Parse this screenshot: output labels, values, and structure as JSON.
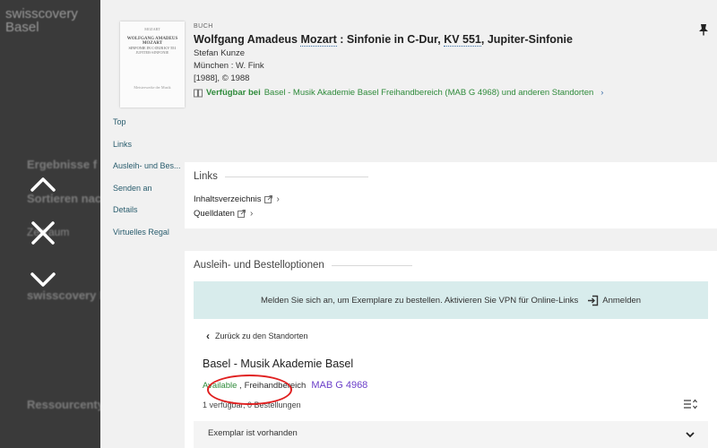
{
  "background": {
    "logo_line1": "swisscovery",
    "logo_line2": "Basel",
    "texts": [
      "Ergebnisse f",
      "Sortieren nac",
      "Zeitraum",
      "swisscovery B",
      "Ressourcenty"
    ]
  },
  "lightbox": {
    "prev_icon": "chevron-up-icon",
    "close_icon": "close-icon",
    "next_icon": "chevron-down-icon"
  },
  "record": {
    "type": "BUCH",
    "title_prefix": "Wolfgang Amadeus ",
    "title_link1": "Mozart",
    "title_mid": " : Sinfonie in C-Dur, ",
    "title_link2": "KV 551",
    "title_suffix": ", Jupiter-Sinfonie",
    "author": "Stefan Kunze",
    "publisher": "München : W. Fink",
    "date": "[1988], © 1988",
    "availability_label": "Verfügbar bei",
    "availability_location": "Basel - Musik Akademie Basel  Freihandbereich (MAB G 4968) und anderen Standorten",
    "thumb": {
      "line1": "MOZART",
      "line2": "WOLFGANG AMADEUS MOZART",
      "line3": "SINFONIE IN C-DUR KV 551",
      "line4": "JUPITER-SINFONIE",
      "line5": "Meisterwerke der Musik"
    }
  },
  "section_nav": [
    "Top",
    "Links",
    "Ausleih- und Bes...",
    "Senden an",
    "Details",
    "Virtuelles Regal"
  ],
  "links": {
    "heading": "Links",
    "items": [
      "Inhaltsverzeichnis",
      "Quelldaten"
    ]
  },
  "loan": {
    "heading": "Ausleih- und Bestelloptionen",
    "login_message": "Melden Sie sich an, um Exemplare zu bestellen. Aktivieren Sie VPN für Online-Links",
    "login_button": "Anmelden",
    "back_label": "Zurück zu den Standorten",
    "library": "Basel - Musik Akademie Basel",
    "status": "Available",
    "location": "Freihandbereich",
    "call_number": "MAB G 4968",
    "counts": "1 verfügbar, 0 Bestellungen",
    "item_label": "Exemplar ist vorhanden"
  },
  "colors": {
    "available_green": "#2e8a3a",
    "call_number_purple": "#6b3fc9",
    "banner_bg": "#d8ecec",
    "annotation_red": "#e02020"
  }
}
